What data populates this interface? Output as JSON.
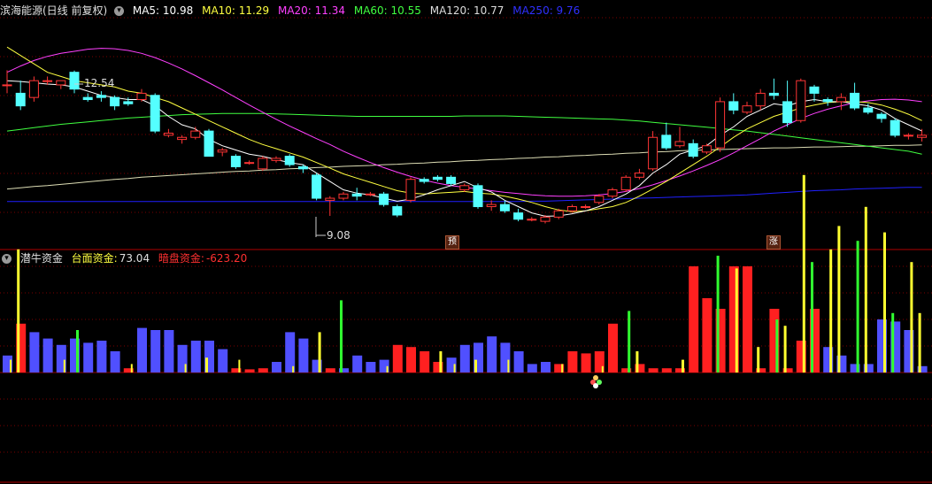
{
  "colors": {
    "up": "#ff3535",
    "down": "#54ffff",
    "ma5": "#ffffff",
    "ma10": "#ffff40",
    "ma20": "#ff40ff",
    "ma60": "#40ff40",
    "ma120": "#dcdcb4",
    "ma250": "#2020ff",
    "grid": "#7a0000",
    "vol_blue": "#5050ff",
    "vol_red": "#ff2020",
    "vol_yellow": "#ffff30",
    "vol_green": "#30ff30"
  },
  "main_header": {
    "title": "滨海能源(日线 前复权)",
    "ma5": "MA5: 10.98",
    "ma10": "MA10: 11.29",
    "ma20": "MA20: 11.34",
    "ma60": "MA60: 10.55",
    "ma120": "MA120: 10.77",
    "ma250": "MA250: 9.76"
  },
  "sub_header": {
    "title": "潜牛资金",
    "open_label": "台面资金:",
    "open_value": "73.04",
    "dark_label": "暗盘资金:",
    "dark_value": "-623.20"
  },
  "annotations": {
    "high_label": "12.54",
    "low_label": "9.08",
    "tag1": "预",
    "tag2": "涨"
  },
  "chart_data": [
    {
      "type": "candlestick",
      "title": "滨海能源(日线 前复权)",
      "ylim": [
        8.7,
        13.8
      ],
      "max_marker": 12.54,
      "min_marker": 9.08,
      "candles": [
        [
          12.2,
          12.2,
          12.55,
          12.0
        ],
        [
          12.0,
          11.7,
          12.3,
          11.6
        ],
        [
          11.9,
          12.3,
          12.4,
          11.8
        ],
        [
          12.3,
          12.3,
          12.4,
          12.2
        ],
        [
          12.2,
          12.3,
          12.3,
          12.1
        ],
        [
          12.5,
          12.1,
          12.54,
          12.0
        ],
        [
          11.9,
          11.85,
          12.0,
          11.8
        ],
        [
          11.95,
          11.9,
          12.05,
          11.8
        ],
        [
          11.9,
          11.7,
          11.95,
          11.6
        ],
        [
          11.8,
          11.75,
          11.9,
          11.7
        ],
        [
          11.85,
          12.0,
          12.1,
          11.8
        ],
        [
          11.95,
          11.1,
          12.0,
          11.05
        ],
        [
          11.0,
          11.05,
          11.15,
          10.95
        ],
        [
          10.9,
          10.95,
          11.0,
          10.8
        ],
        [
          10.95,
          11.1,
          11.2,
          10.9
        ],
        [
          11.1,
          10.5,
          11.15,
          10.5
        ],
        [
          10.6,
          10.65,
          10.7,
          10.5
        ],
        [
          10.5,
          10.25,
          10.55,
          10.2
        ],
        [
          10.35,
          10.35,
          10.4,
          10.3
        ],
        [
          10.2,
          10.45,
          10.5,
          10.15
        ],
        [
          10.4,
          10.45,
          10.5,
          10.35
        ],
        [
          10.5,
          10.3,
          10.55,
          10.25
        ],
        [
          10.25,
          10.2,
          10.3,
          10.1
        ],
        [
          10.05,
          9.5,
          10.1,
          9.45
        ],
        [
          9.45,
          9.5,
          9.55,
          9.08
        ],
        [
          9.5,
          9.6,
          9.65,
          9.45
        ],
        [
          9.6,
          9.55,
          9.75,
          9.45
        ],
        [
          9.6,
          9.6,
          9.65,
          9.55
        ],
        [
          9.6,
          9.35,
          9.65,
          9.3
        ],
        [
          9.3,
          9.1,
          9.35,
          9.05
        ],
        [
          9.45,
          9.95,
          10.0,
          9.4
        ],
        [
          9.95,
          9.9,
          10.0,
          9.85
        ],
        [
          10.0,
          9.95,
          10.05,
          9.9
        ],
        [
          10.0,
          9.85,
          10.05,
          9.8
        ],
        [
          9.7,
          9.8,
          9.85,
          9.65
        ],
        [
          9.8,
          9.3,
          9.85,
          9.25
        ],
        [
          9.3,
          9.35,
          9.45,
          9.2
        ],
        [
          9.35,
          9.2,
          9.45,
          9.15
        ],
        [
          9.15,
          9.0,
          9.25,
          8.95
        ],
        [
          9.0,
          9.0,
          9.05,
          8.95
        ],
        [
          8.95,
          9.05,
          9.1,
          8.9
        ],
        [
          9.05,
          9.2,
          9.25,
          9.0
        ],
        [
          9.2,
          9.3,
          9.35,
          9.15
        ],
        [
          9.3,
          9.3,
          9.35,
          9.25
        ],
        [
          9.4,
          9.55,
          9.6,
          9.35
        ],
        [
          9.55,
          9.7,
          9.75,
          9.5
        ],
        [
          9.7,
          10.0,
          10.05,
          9.65
        ],
        [
          10.0,
          10.1,
          10.2,
          9.95
        ],
        [
          10.2,
          10.95,
          11.1,
          10.15
        ],
        [
          11.0,
          10.7,
          11.3,
          10.65
        ],
        [
          10.75,
          10.85,
          11.2,
          10.7
        ],
        [
          10.8,
          10.5,
          10.9,
          10.45
        ],
        [
          10.6,
          10.75,
          10.8,
          10.55
        ],
        [
          10.7,
          11.8,
          11.9,
          10.6
        ],
        [
          11.8,
          11.6,
          12.0,
          11.5
        ],
        [
          11.55,
          11.7,
          11.8,
          11.5
        ],
        [
          11.7,
          12.0,
          12.1,
          11.6
        ],
        [
          12.0,
          11.95,
          12.35,
          11.85
        ],
        [
          11.8,
          11.3,
          12.3,
          11.2
        ],
        [
          11.35,
          12.3,
          12.35,
          11.3
        ],
        [
          12.15,
          12.0,
          12.2,
          11.8
        ],
        [
          11.85,
          11.8,
          11.9,
          11.7
        ],
        [
          11.8,
          11.9,
          12.0,
          11.6
        ],
        [
          12.0,
          11.65,
          12.25,
          11.6
        ],
        [
          11.65,
          11.55,
          11.75,
          11.5
        ],
        [
          11.5,
          11.4,
          11.55,
          11.3
        ],
        [
          11.35,
          11.0,
          11.4,
          10.95
        ],
        [
          11.0,
          11.0,
          11.05,
          10.9
        ],
        [
          10.95,
          11.0,
          11.15,
          10.85
        ]
      ],
      "ma5": [
        12.3,
        12.28,
        12.25,
        12.22,
        12.2,
        12.15,
        12.05,
        11.95,
        11.9,
        11.85,
        11.85,
        11.7,
        11.45,
        11.25,
        11.15,
        10.9,
        10.75,
        10.65,
        10.55,
        10.5,
        10.42,
        10.35,
        10.3,
        10.1,
        9.9,
        9.7,
        9.62,
        9.58,
        9.5,
        9.43,
        9.48,
        9.58,
        9.7,
        9.8,
        9.9,
        9.75,
        9.65,
        9.45,
        9.3,
        9.15,
        9.07,
        9.08,
        9.13,
        9.2,
        9.3,
        9.45,
        9.6,
        9.8,
        10.1,
        10.3,
        10.55,
        10.65,
        10.75,
        11.0,
        11.2,
        11.45,
        11.6,
        11.75,
        11.7,
        11.8,
        11.85,
        11.8,
        11.8,
        11.75,
        11.7,
        11.6,
        11.4,
        11.25,
        11.1
      ],
      "ma10": [
        13.1,
        12.9,
        12.7,
        12.5,
        12.4,
        12.3,
        12.25,
        12.2,
        12.15,
        12.05,
        12.0,
        11.9,
        11.8,
        11.65,
        11.5,
        11.35,
        11.2,
        11.05,
        10.9,
        10.78,
        10.68,
        10.58,
        10.48,
        10.35,
        10.22,
        10.08,
        9.98,
        9.88,
        9.78,
        9.68,
        9.62,
        9.6,
        9.62,
        9.64,
        9.66,
        9.62,
        9.6,
        9.55,
        9.48,
        9.4,
        9.3,
        9.22,
        9.18,
        9.2,
        9.25,
        9.3,
        9.4,
        9.55,
        9.72,
        9.9,
        10.1,
        10.3,
        10.5,
        10.72,
        10.95,
        11.15,
        11.3,
        11.45,
        11.55,
        11.65,
        11.72,
        11.78,
        11.8,
        11.8,
        11.78,
        11.72,
        11.62,
        11.5,
        11.35
      ],
      "ma20": [
        12.5,
        12.65,
        12.78,
        12.88,
        12.95,
        13.0,
        13.05,
        13.07,
        13.06,
        13.02,
        12.95,
        12.85,
        12.72,
        12.58,
        12.42,
        12.25,
        12.08,
        11.9,
        11.72,
        11.55,
        11.38,
        11.22,
        11.07,
        10.92,
        10.78,
        10.62,
        10.48,
        10.35,
        10.23,
        10.12,
        10.02,
        9.93,
        9.86,
        9.8,
        9.76,
        9.72,
        9.68,
        9.64,
        9.61,
        9.58,
        9.56,
        9.55,
        9.55,
        9.56,
        9.58,
        9.61,
        9.66,
        9.73,
        9.82,
        9.92,
        10.03,
        10.15,
        10.28,
        10.42,
        10.58,
        10.75,
        10.92,
        11.1,
        11.25,
        11.4,
        11.52,
        11.62,
        11.7,
        11.77,
        11.82,
        11.85,
        11.86,
        11.84,
        11.8
      ],
      "ma60": [
        11.1,
        11.14,
        11.18,
        11.22,
        11.26,
        11.29,
        11.32,
        11.35,
        11.38,
        11.41,
        11.43,
        11.45,
        11.47,
        11.49,
        11.5,
        11.51,
        11.52,
        11.52,
        11.52,
        11.52,
        11.51,
        11.5,
        11.49,
        11.48,
        11.47,
        11.46,
        11.45,
        11.45,
        11.45,
        11.45,
        11.45,
        11.45,
        11.45,
        11.45,
        11.46,
        11.46,
        11.46,
        11.46,
        11.45,
        11.44,
        11.43,
        11.42,
        11.41,
        11.4,
        11.39,
        11.38,
        11.36,
        11.34,
        11.31,
        11.28,
        11.25,
        11.22,
        11.19,
        11.16,
        11.13,
        11.1,
        11.06,
        11.02,
        10.98,
        10.94,
        10.9,
        10.86,
        10.82,
        10.78,
        10.74,
        10.7,
        10.66,
        10.62,
        10.55
      ],
      "ma120": [
        9.72,
        9.75,
        9.78,
        9.8,
        9.83,
        9.86,
        9.89,
        9.92,
        9.95,
        9.97,
        10.0,
        10.02,
        10.04,
        10.06,
        10.08,
        10.1,
        10.12,
        10.14,
        10.15,
        10.17,
        10.18,
        10.2,
        10.21,
        10.23,
        10.24,
        10.26,
        10.27,
        10.28,
        10.3,
        10.31,
        10.33,
        10.34,
        10.36,
        10.37,
        10.39,
        10.4,
        10.42,
        10.43,
        10.45,
        10.46,
        10.48,
        10.49,
        10.51,
        10.52,
        10.54,
        10.55,
        10.57,
        10.58,
        10.6,
        10.61,
        10.63,
        10.64,
        10.65,
        10.66,
        10.67,
        10.68,
        10.69,
        10.7,
        10.7,
        10.71,
        10.72,
        10.72,
        10.73,
        10.74,
        10.74,
        10.75,
        10.76,
        10.76,
        10.77
      ],
      "ma250": [
        9.42,
        9.42,
        9.42,
        9.42,
        9.42,
        9.42,
        9.42,
        9.42,
        9.42,
        9.42,
        9.42,
        9.42,
        9.42,
        9.42,
        9.42,
        9.42,
        9.42,
        9.42,
        9.42,
        9.42,
        9.42,
        9.42,
        9.42,
        9.42,
        9.42,
        9.42,
        9.42,
        9.42,
        9.42,
        9.42,
        9.42,
        9.42,
        9.42,
        9.42,
        9.42,
        9.42,
        9.42,
        9.42,
        9.42,
        9.43,
        9.43,
        9.44,
        9.45,
        9.46,
        9.47,
        9.48,
        9.49,
        9.5,
        9.51,
        9.52,
        9.53,
        9.54,
        9.55,
        9.56,
        9.57,
        9.58,
        9.6,
        9.62,
        9.64,
        9.66,
        9.68,
        9.69,
        9.7,
        9.72,
        9.73,
        9.74,
        9.75,
        9.76,
        9.76
      ]
    },
    {
      "type": "bar",
      "title": "潜牛资金",
      "ylim": [
        -300,
        1100
      ],
      "bars": [
        [
          "blue",
          80
        ],
        [
          "red",
          230
        ],
        [
          "blue",
          190
        ],
        [
          "blue",
          160
        ],
        [
          "blue",
          130
        ],
        [
          "blue",
          160
        ],
        [
          "blue",
          140
        ],
        [
          "blue",
          150
        ],
        [
          "blue",
          100
        ],
        [
          "red",
          20
        ],
        [
          "blue",
          210
        ],
        [
          "blue",
          200
        ],
        [
          "blue",
          200
        ],
        [
          "blue",
          130
        ],
        [
          "blue",
          150
        ],
        [
          "blue",
          150
        ],
        [
          "blue",
          110
        ],
        [
          "red",
          20
        ],
        [
          "red",
          15
        ],
        [
          "red",
          20
        ],
        [
          "blue",
          50
        ],
        [
          "blue",
          190
        ],
        [
          "blue",
          160
        ],
        [
          "blue",
          60
        ],
        [
          "red",
          20
        ],
        [
          "blue",
          20
        ],
        [
          "blue",
          80
        ],
        [
          "blue",
          50
        ],
        [
          "blue",
          60
        ],
        [
          "red",
          130
        ],
        [
          "red",
          120
        ],
        [
          "red",
          100
        ],
        [
          "red",
          50
        ],
        [
          "blue",
          70
        ],
        [
          "blue",
          130
        ],
        [
          "blue",
          140
        ],
        [
          "blue",
          170
        ],
        [
          "blue",
          140
        ],
        [
          "blue",
          100
        ],
        [
          "blue",
          40
        ],
        [
          "blue",
          50
        ],
        [
          "red",
          40
        ],
        [
          "red",
          100
        ],
        [
          "red",
          90
        ],
        [
          "red",
          100
        ],
        [
          "red",
          230
        ],
        [
          "red",
          20
        ],
        [
          "red",
          40
        ],
        [
          "red",
          20
        ],
        [
          "red",
          20
        ],
        [
          "red",
          20
        ],
        [
          "red",
          500
        ],
        [
          "red",
          350
        ],
        [
          "red",
          300
        ],
        [
          "red",
          500
        ],
        [
          "red",
          500
        ],
        [
          "red",
          20
        ],
        [
          "red",
          300
        ],
        [
          "red",
          20
        ],
        [
          "red",
          150
        ],
        [
          "red",
          300
        ],
        [
          "blue",
          120
        ],
        [
          "blue",
          80
        ],
        [
          "blue",
          40
        ],
        [
          "blue",
          40
        ],
        [
          "blue",
          250
        ],
        [
          "blue",
          240
        ],
        [
          "blue",
          200
        ],
        [
          "blue",
          30
        ]
      ],
      "lines": [
        [
          1,
          580
        ],
        [
          5,
          200
        ],
        [
          15,
          70
        ],
        [
          23,
          190
        ],
        [
          25,
          340
        ],
        [
          32,
          100
        ],
        [
          35,
          60
        ],
        [
          46,
          290
        ],
        [
          47,
          100
        ],
        [
          50,
          60
        ],
        [
          53,
          550
        ],
        [
          54,
          490
        ],
        [
          56,
          120
        ],
        [
          57,
          250
        ],
        [
          58,
          220
        ],
        [
          59,
          930
        ],
        [
          60,
          520
        ],
        [
          61,
          580
        ],
        [
          62,
          690
        ],
        [
          63,
          620
        ],
        [
          64,
          780
        ],
        [
          65,
          660
        ],
        [
          66,
          280
        ],
        [
          67,
          520
        ],
        [
          68,
          280
        ]
      ],
      "tiny_ticks": [
        [
          0,
          60
        ],
        [
          4,
          60
        ],
        [
          9,
          40
        ],
        [
          13,
          40
        ],
        [
          17,
          60
        ],
        [
          21,
          30
        ],
        [
          28,
          30
        ],
        [
          33,
          40
        ],
        [
          37,
          60
        ],
        [
          41,
          40
        ],
        [
          44,
          30
        ]
      ]
    }
  ]
}
